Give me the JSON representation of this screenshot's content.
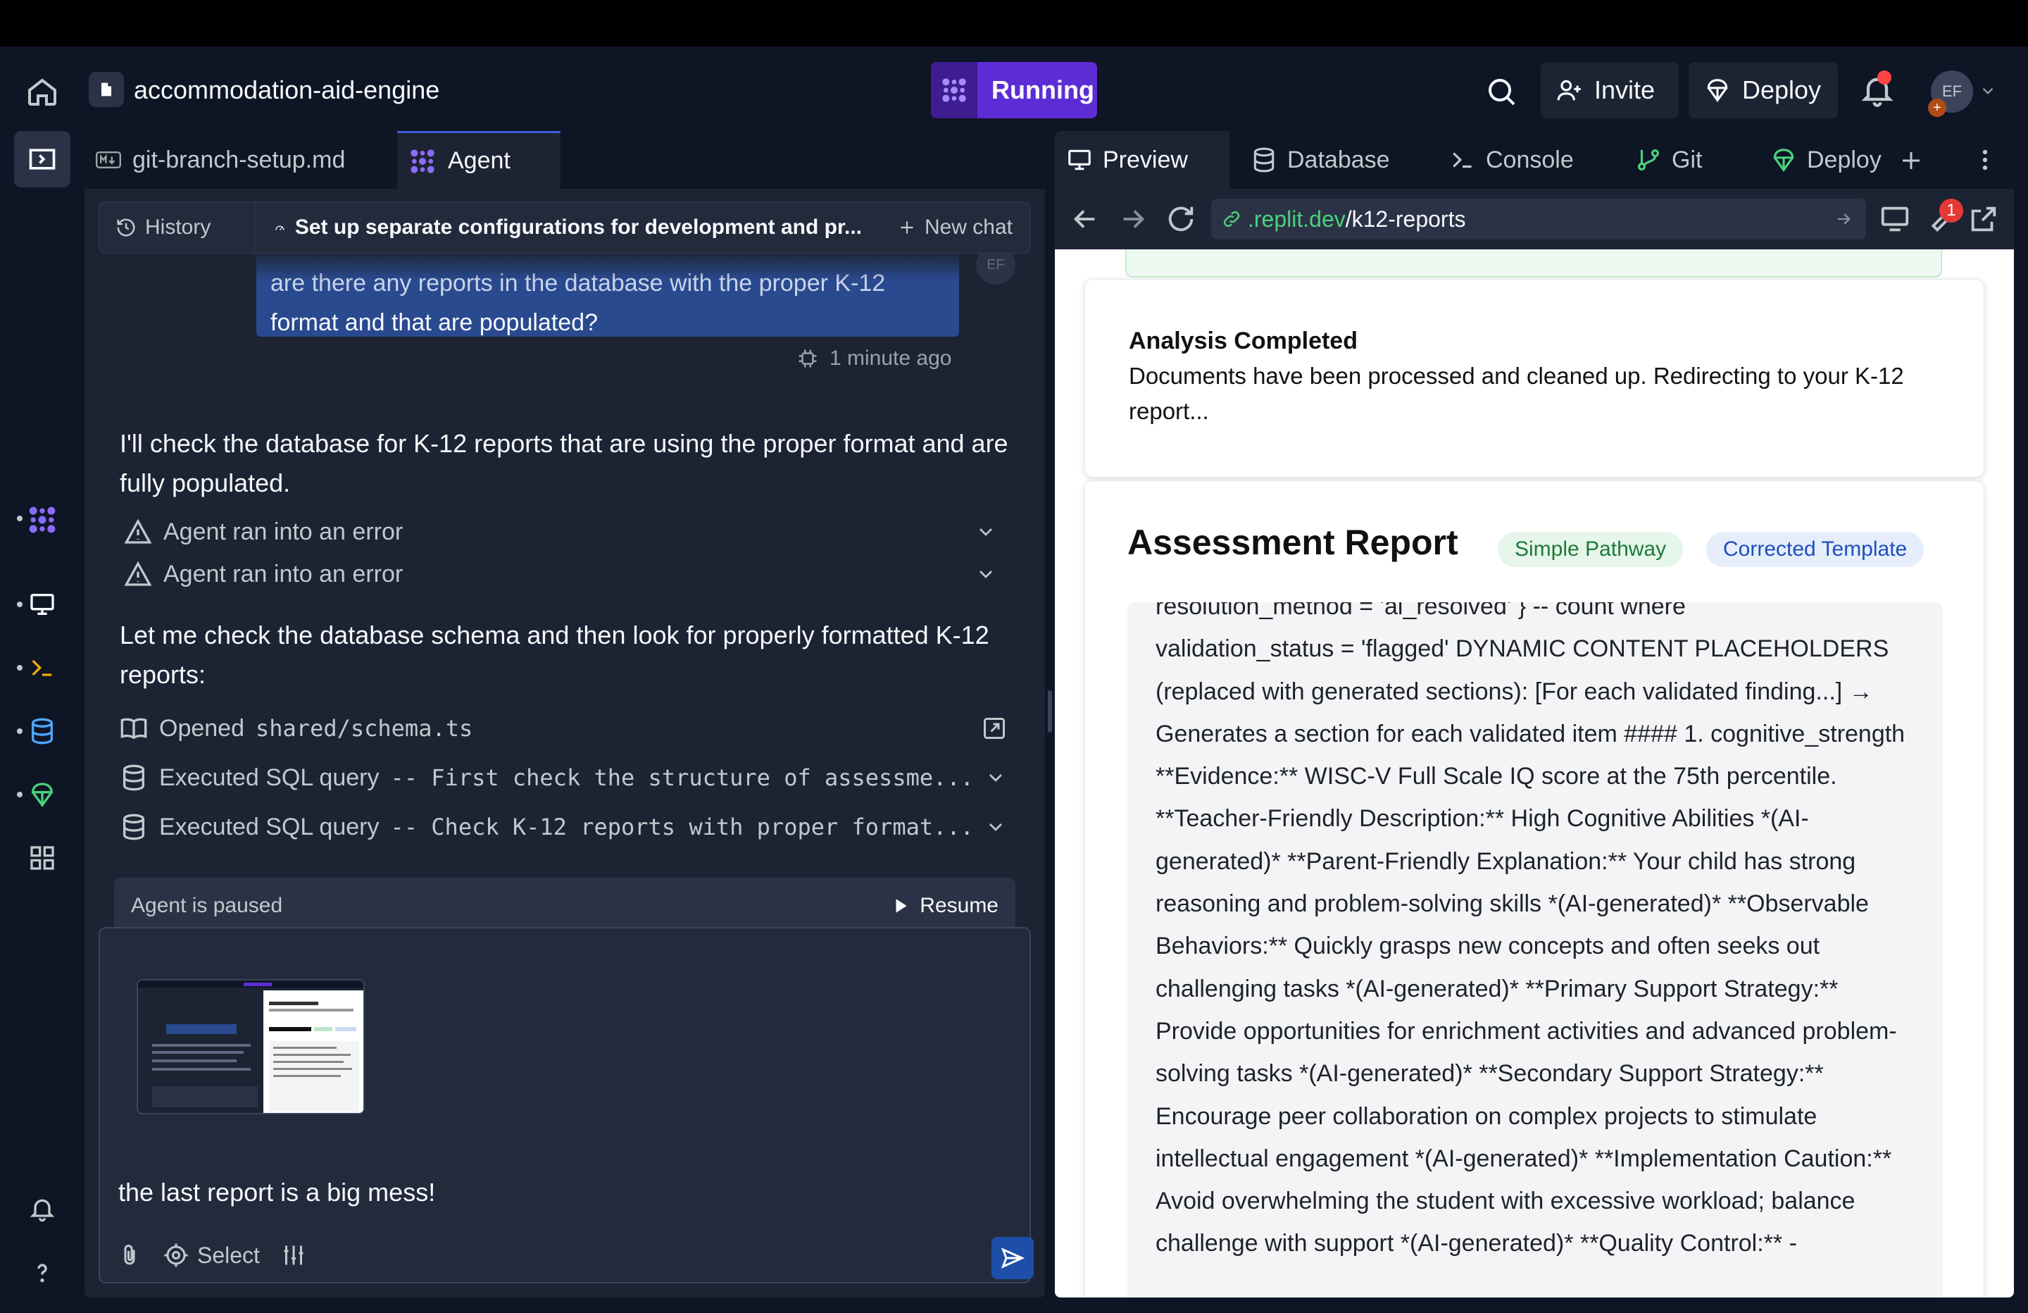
{
  "header": {
    "project_name": "accommodation-aid-engine",
    "run_label": "Running",
    "invite_label": "Invite",
    "deploy_label": "Deploy",
    "avatar_initials": "EF"
  },
  "left_tabs": [
    {
      "label": "git-branch-setup.md"
    },
    {
      "label": "Agent"
    }
  ],
  "chat_bar": {
    "history_label": "History",
    "title": "Set up separate configurations for development and pr...",
    "new_chat_label": "New chat"
  },
  "conversation": {
    "user_message_partial": "are there any reports in the database with the proper K-12",
    "user_message_line2": "format and that are populated?",
    "user_avatar": "EF",
    "timestamp": "1 minute ago",
    "agent_message_1": "I'll check the database for K-12 reports that are using the proper format and are fully populated.",
    "errors": [
      "Agent ran into an error",
      "Agent ran into an error"
    ],
    "agent_message_2": "Let me check the database schema and then look for properly formatted K-12 reports:",
    "actions": [
      {
        "label": "Opened",
        "detail": "shared/schema.ts"
      },
      {
        "label": "Executed SQL query",
        "detail": "-- First check the structure of assessme..."
      },
      {
        "label": "Executed SQL query",
        "detail": "-- Check K-12 reports with proper format..."
      }
    ]
  },
  "paused_bar": {
    "status": "Agent is paused",
    "resume_label": "Resume"
  },
  "composer": {
    "text": "the last report is a big mess!",
    "select_label": "Select"
  },
  "right_tabs": [
    {
      "label": "Preview"
    },
    {
      "label": "Database"
    },
    {
      "label": "Console"
    },
    {
      "label": "Git"
    },
    {
      "label": "Deploy"
    }
  ],
  "url": {
    "host": ".replit.dev",
    "path": "/k12-reports"
  },
  "devtools_badge": "1",
  "preview": {
    "card_title": "Analysis Completed",
    "card_body": "Documents have been processed and cleaned up. Redirecting to your K-12 report...",
    "report_title": "Assessment Report",
    "pill_1": "Simple Pathway",
    "pill_2": "Corrected Template",
    "report_text_top": "resolution_method = 'ai_resolved' } -- count where",
    "report_text": "validation_status = 'flagged' DYNAMIC CONTENT PLACEHOLDERS (replaced with generated sections): [For each validated finding...] → Generates a section for each validated item #### 1. cognitive_strength **Evidence:** WISC-V Full Scale IQ score at the 75th percentile. **Teacher-Friendly Description:** High Cognitive Abilities *(AI-generated)* **Parent-Friendly Explanation:** Your child has strong reasoning and problem-solving skills *(AI-generated)* **Observable Behaviors:** Quickly grasps new concepts and often seeks out challenging tasks *(AI-generated)* **Primary Support Strategy:** Provide opportunities for enrichment activities and advanced problem-solving tasks *(AI-generated)* **Secondary Support Strategy:** Encourage peer collaboration on complex projects to stimulate intellectual engagement *(AI-generated)* **Implementation Caution:** Avoid overwhelming the student with excessive workload; balance challenge with support *(AI-generated)* **Quality Control:** -"
  }
}
